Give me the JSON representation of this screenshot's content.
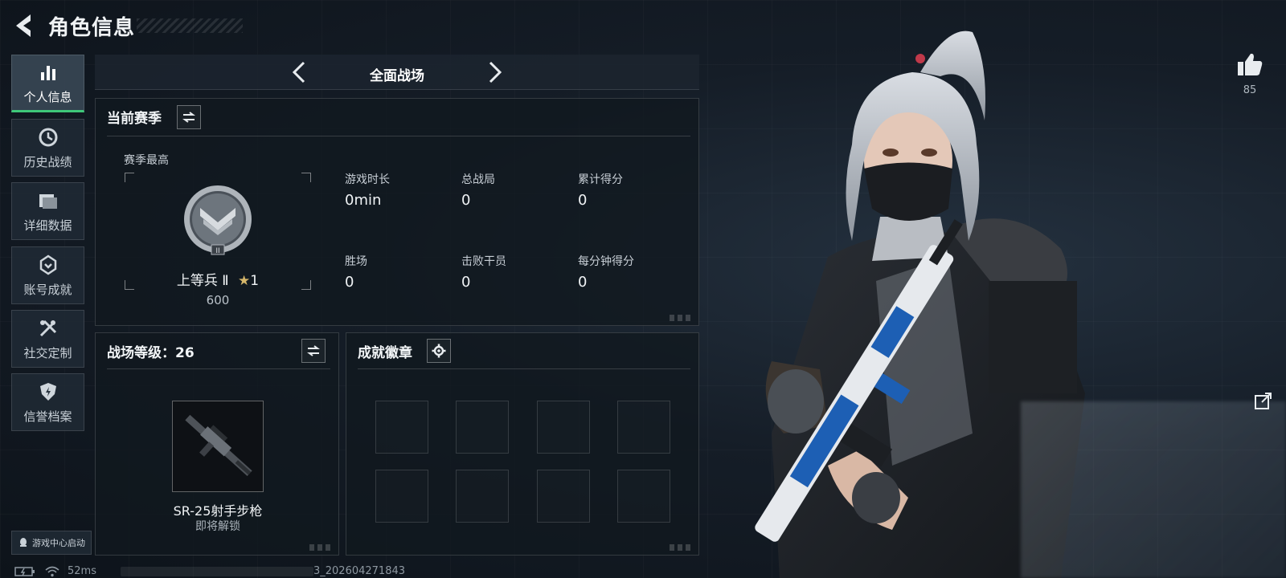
{
  "header": {
    "title": "角色信息",
    "back_icon": "back-arrow-icon"
  },
  "sidebar": {
    "items": [
      {
        "label": "个人信息",
        "icon": "bar-chart-icon",
        "active": true
      },
      {
        "label": "历史战绩",
        "icon": "history-clock-icon",
        "active": false
      },
      {
        "label": "详细数据",
        "icon": "folder-data-icon",
        "active": false
      },
      {
        "label": "账号成就",
        "icon": "trophy-badge-icon",
        "active": false
      },
      {
        "label": "社交定制",
        "icon": "tools-icon",
        "active": false
      },
      {
        "label": "信誉档案",
        "icon": "credit-shield-icon",
        "active": false
      }
    ],
    "launch_label": "游戏中心启动"
  },
  "mode": {
    "title": "全面战场"
  },
  "season": {
    "header": "当前赛季",
    "best_label": "赛季最高",
    "rank_name": "上等兵 Ⅱ",
    "stars": "1",
    "score": "600",
    "stats": [
      {
        "label": "游戏时长",
        "value": "0min"
      },
      {
        "label": "总战局",
        "value": "0"
      },
      {
        "label": "累计得分",
        "value": "0"
      },
      {
        "label": "胜场",
        "value": "0"
      },
      {
        "label": "击败干员",
        "value": "0"
      },
      {
        "label": "每分钟得分",
        "value": "0"
      }
    ]
  },
  "battle_level": {
    "header": "战场等级：26",
    "weapon_name": "SR-25射手步枪",
    "weapon_status": "即将解锁"
  },
  "achievements": {
    "header": "成就徽章",
    "slot_count": 8
  },
  "likes": {
    "count": "85"
  },
  "status": {
    "ping": "52ms",
    "build": "3_202604271843"
  },
  "colors": {
    "accent_green": "#3ec779",
    "panel_bg": "#11181f"
  }
}
